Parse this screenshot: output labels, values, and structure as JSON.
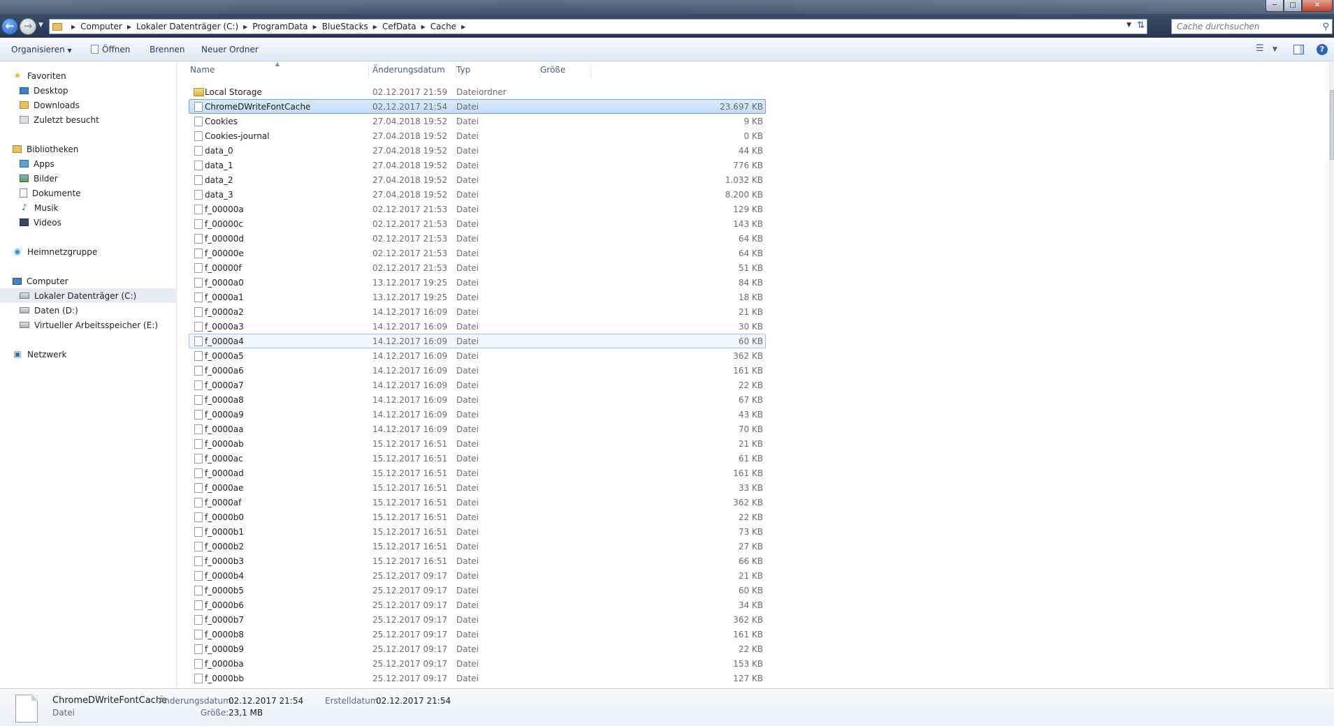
{
  "breadcrumbs": [
    "Computer",
    "Lokaler Datenträger (C:)",
    "ProgramData",
    "BlueStacks",
    "CefData",
    "Cache"
  ],
  "search": {
    "placeholder": "Cache durchsuchen"
  },
  "toolbar": {
    "organize_label": "Organisieren",
    "open_label": "Öffnen",
    "burn_label": "Brennen",
    "new_folder_label": "Neuer Ordner"
  },
  "columns": {
    "name": "Name",
    "date": "Änderungsdatum",
    "type": "Typ",
    "size": "Größe"
  },
  "navigation": {
    "favorites": "Favoriten",
    "desktop": "Desktop",
    "downloads": "Downloads",
    "recent": "Zuletzt besucht",
    "libraries": "Bibliotheken",
    "apps": "Apps",
    "pictures": "Bilder",
    "documents": "Dokumente",
    "music": "Musik",
    "videos": "Videos",
    "homegroup": "Heimnetzgruppe",
    "computer": "Computer",
    "drive_c": "Lokaler Datenträger (C:)",
    "drive_d": "Daten (D:)",
    "drive_e": "Virtueller Arbeitsspeicher (E:)",
    "network": "Netzwerk"
  },
  "files": [
    {
      "name": "Local Storage",
      "date": "02.12.2017 21:59",
      "type": "Dateiordner",
      "size": ""
    },
    {
      "name": "ChromeDWriteFontCache",
      "date": "02.12.2017 21:54",
      "type": "Datei",
      "size": "23.697 KB"
    },
    {
      "name": "Cookies",
      "date": "27.04.2018 19:52",
      "type": "Datei",
      "size": "9 KB"
    },
    {
      "name": "Cookies-journal",
      "date": "27.04.2018 19:52",
      "type": "Datei",
      "size": "0 KB"
    },
    {
      "name": "data_0",
      "date": "27.04.2018 19:52",
      "type": "Datei",
      "size": "44 KB"
    },
    {
      "name": "data_1",
      "date": "27.04.2018 19:52",
      "type": "Datei",
      "size": "776 KB"
    },
    {
      "name": "data_2",
      "date": "27.04.2018 19:52",
      "type": "Datei",
      "size": "1.032 KB"
    },
    {
      "name": "data_3",
      "date": "27.04.2018 19:52",
      "type": "Datei",
      "size": "8.200 KB"
    },
    {
      "name": "f_00000a",
      "date": "02.12.2017 21:53",
      "type": "Datei",
      "size": "129 KB"
    },
    {
      "name": "f_00000c",
      "date": "02.12.2017 21:53",
      "type": "Datei",
      "size": "143 KB"
    },
    {
      "name": "f_00000d",
      "date": "02.12.2017 21:53",
      "type": "Datei",
      "size": "64 KB"
    },
    {
      "name": "f_00000e",
      "date": "02.12.2017 21:53",
      "type": "Datei",
      "size": "64 KB"
    },
    {
      "name": "f_00000f",
      "date": "02.12.2017 21:53",
      "type": "Datei",
      "size": "51 KB"
    },
    {
      "name": "f_0000a0",
      "date": "13.12.2017 19:25",
      "type": "Datei",
      "size": "84 KB"
    },
    {
      "name": "f_0000a1",
      "date": "13.12.2017 19:25",
      "type": "Datei",
      "size": "18 KB"
    },
    {
      "name": "f_0000a2",
      "date": "14.12.2017 16:09",
      "type": "Datei",
      "size": "21 KB"
    },
    {
      "name": "f_0000a3",
      "date": "14.12.2017 16:09",
      "type": "Datei",
      "size": "30 KB"
    },
    {
      "name": "f_0000a4",
      "date": "14.12.2017 16:09",
      "type": "Datei",
      "size": "60 KB"
    },
    {
      "name": "f_0000a5",
      "date": "14.12.2017 16:09",
      "type": "Datei",
      "size": "362 KB"
    },
    {
      "name": "f_0000a6",
      "date": "14.12.2017 16:09",
      "type": "Datei",
      "size": "161 KB"
    },
    {
      "name": "f_0000a7",
      "date": "14.12.2017 16:09",
      "type": "Datei",
      "size": "22 KB"
    },
    {
      "name": "f_0000a8",
      "date": "14.12.2017 16:09",
      "type": "Datei",
      "size": "67 KB"
    },
    {
      "name": "f_0000a9",
      "date": "14.12.2017 16:09",
      "type": "Datei",
      "size": "43 KB"
    },
    {
      "name": "f_0000aa",
      "date": "14.12.2017 16:09",
      "type": "Datei",
      "size": "70 KB"
    },
    {
      "name": "f_0000ab",
      "date": "15.12.2017 16:51",
      "type": "Datei",
      "size": "21 KB"
    },
    {
      "name": "f_0000ac",
      "date": "15.12.2017 16:51",
      "type": "Datei",
      "size": "61 KB"
    },
    {
      "name": "f_0000ad",
      "date": "15.12.2017 16:51",
      "type": "Datei",
      "size": "161 KB"
    },
    {
      "name": "f_0000ae",
      "date": "15.12.2017 16:51",
      "type": "Datei",
      "size": "33 KB"
    },
    {
      "name": "f_0000af",
      "date": "15.12.2017 16:51",
      "type": "Datei",
      "size": "362 KB"
    },
    {
      "name": "f_0000b0",
      "date": "15.12.2017 16:51",
      "type": "Datei",
      "size": "22 KB"
    },
    {
      "name": "f_0000b1",
      "date": "15.12.2017 16:51",
      "type": "Datei",
      "size": "73 KB"
    },
    {
      "name": "f_0000b2",
      "date": "15.12.2017 16:51",
      "type": "Datei",
      "size": "27 KB"
    },
    {
      "name": "f_0000b3",
      "date": "15.12.2017 16:51",
      "type": "Datei",
      "size": "66 KB"
    },
    {
      "name": "f_0000b4",
      "date": "25.12.2017 09:17",
      "type": "Datei",
      "size": "21 KB"
    },
    {
      "name": "f_0000b5",
      "date": "25.12.2017 09:17",
      "type": "Datei",
      "size": "60 KB"
    },
    {
      "name": "f_0000b6",
      "date": "25.12.2017 09:17",
      "type": "Datei",
      "size": "34 KB"
    },
    {
      "name": "f_0000b7",
      "date": "25.12.2017 09:17",
      "type": "Datei",
      "size": "362 KB"
    },
    {
      "name": "f_0000b8",
      "date": "25.12.2017 09:17",
      "type": "Datei",
      "size": "161 KB"
    },
    {
      "name": "f_0000b9",
      "date": "25.12.2017 09:17",
      "type": "Datei",
      "size": "22 KB"
    },
    {
      "name": "f_0000ba",
      "date": "25.12.2017 09:17",
      "type": "Datei",
      "size": "153 KB"
    },
    {
      "name": "f_0000bb",
      "date": "25.12.2017 09:17",
      "type": "Datei",
      "size": "127 KB"
    }
  ],
  "details": {
    "name": "ChromeDWriteFontCache",
    "type": "Datei",
    "modified_label": "Änderungsdatum:",
    "modified_value": "02.12.2017 21:54",
    "size_label": "Größe:",
    "size_value": "23,1 MB",
    "created_label": "Erstelldatum:",
    "created_value": "02.12.2017 21:54"
  },
  "icons": {
    "back": "arrow-left-icon",
    "forward": "arrow-right-icon",
    "search": "magnifier-icon",
    "refresh": "refresh-icon",
    "help": "help-icon"
  },
  "colors": {
    "selection": "#c1dbfc",
    "accent": "#2b64c0",
    "titlebar": "#3b4d66"
  }
}
